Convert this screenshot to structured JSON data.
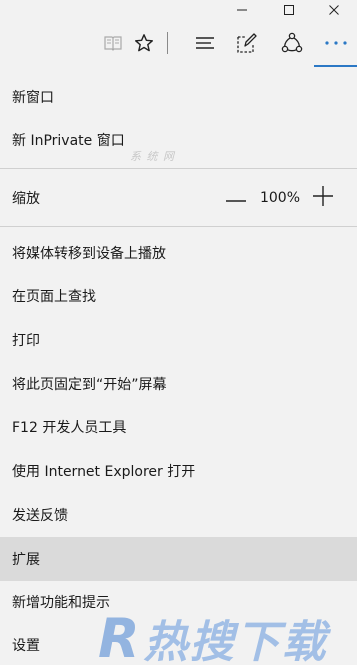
{
  "titlebar": {
    "minimize_icon": "minimize-icon",
    "maximize_icon": "maximize-icon",
    "close_icon": "close-icon"
  },
  "toolbar": {
    "icons": [
      "reading-view-icon",
      "favorite-star-icon",
      "hub-icon",
      "web-note-icon",
      "share-icon",
      "more-actions-icon"
    ],
    "accent_color": "#2b78c5"
  },
  "menu": {
    "new_window": "新窗口",
    "new_inprivate": "新 InPrivate 窗口",
    "zoom_label": "缩放",
    "zoom_minus": "—",
    "zoom_value": "100%",
    "zoom_plus": "+",
    "cast": "将媒体转移到设备上播放",
    "find": "在页面上查找",
    "print": "打印",
    "pin_start": "将此页固定到“开始”屏幕",
    "f12": "F12 开发人员工具",
    "open_ie": "使用 Internet Explorer 打开",
    "feedback": "发送反馈",
    "extensions": "扩展",
    "whats_new": "新增功能和提示",
    "settings": "设置",
    "hover_color": "#dadada"
  },
  "watermark": {
    "small": "系 统 网",
    "logo_letter": "R",
    "logo_text": "热搜下载"
  }
}
